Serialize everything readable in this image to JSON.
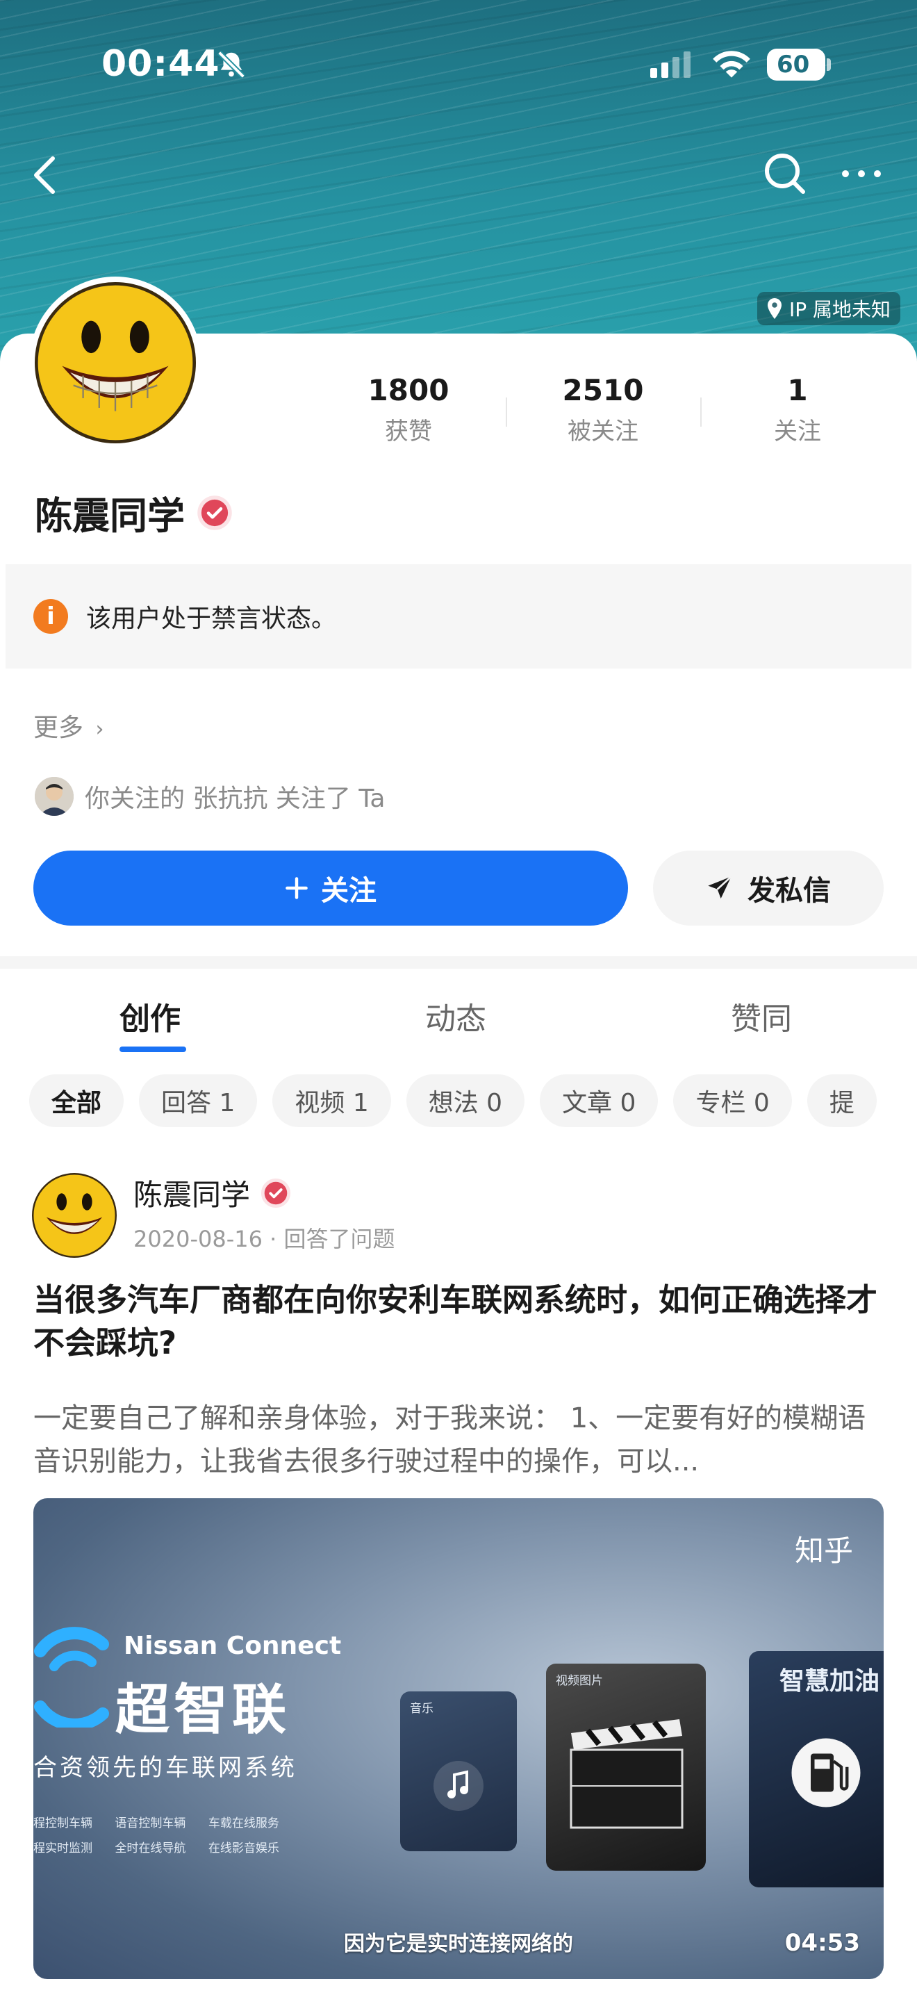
{
  "status_bar": {
    "time": "00:44",
    "battery": "60"
  },
  "profile": {
    "ip_location": "IP 属地未知",
    "stats": [
      {
        "value": "1800",
        "label": "获赞"
      },
      {
        "value": "2510",
        "label": "被关注"
      },
      {
        "value": "1",
        "label": "关注"
      }
    ],
    "name": "陈震同学",
    "notice": "该用户处于禁言状态。",
    "more": "更多",
    "mutual_text": "你关注的 张抗抗 关注了 Ta",
    "follow_label": "关注",
    "message_label": "发私信"
  },
  "tabs": [
    {
      "label": "创作",
      "active": true
    },
    {
      "label": "动态",
      "active": false
    },
    {
      "label": "赞同",
      "active": false
    }
  ],
  "chips": [
    "全部",
    "回答 1",
    "视频 1",
    "想法 0",
    "文章 0",
    "专栏 0",
    "提"
  ],
  "post": {
    "author": "陈震同学",
    "meta": "2020-08-16 · 回答了问题",
    "title": "当很多汽车厂商都在向你安利车联网系统时，如何正确选择才不会踩坑?",
    "excerpt": "一定要自己了解和亲身体验，对于我来说： 1、一定要有好的模糊语音识别能力，让我省去很多行驶过程中的操作，可以...",
    "video": {
      "watermark": "知乎",
      "brand": "Nissan Connect",
      "product": "超智联",
      "tagline": "合资领先的车联网系统",
      "features": "程控制车辆      语音控制车辆      车载在线服务\n程实时监测      全时在线导航      在线影音娱乐",
      "panel_music": "音乐",
      "panel_video": "视频图片",
      "panel_fuel": "智慧加油",
      "subtitle": "因为它是实时连接网络的",
      "duration": "04:53"
    }
  },
  "colors": {
    "accent": "#1a72f5",
    "warning": "#f27b1f",
    "verified": "#e0475a"
  }
}
